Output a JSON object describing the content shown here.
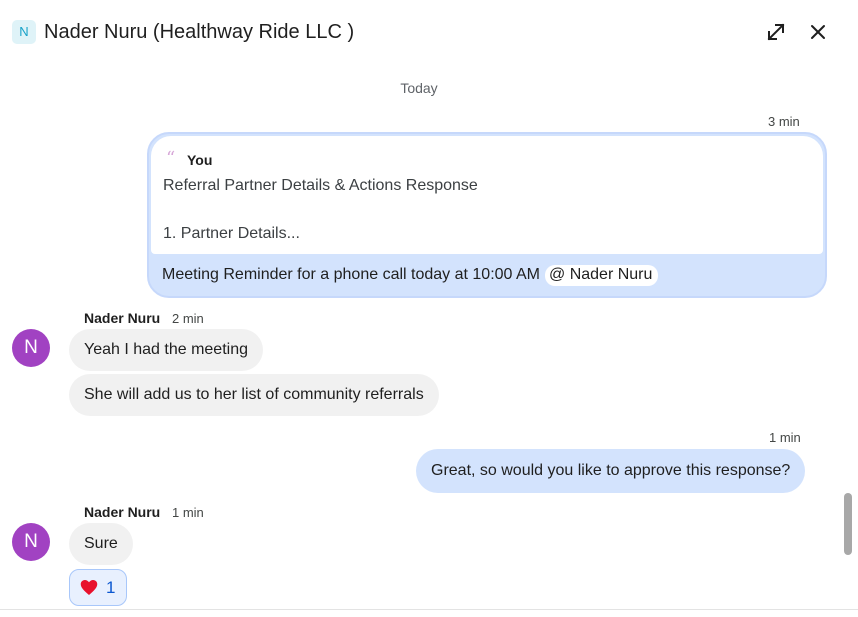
{
  "header": {
    "space_initial": "N",
    "title": "Nader Nuru (Healthway Ride LLC )",
    "expand_icon": "open-in-full-icon",
    "close_icon": "close-icon"
  },
  "day_divider": "Today",
  "messages": [
    {
      "direction": "outgoing",
      "time": "3 min",
      "quote": {
        "author": "You",
        "line1": "Referral Partner Details & Actions Response",
        "line2": "1. Partner Details..."
      },
      "text": "Meeting Reminder for a phone call today at 10:00 AM",
      "mention": "@ Nader Nuru"
    },
    {
      "direction": "incoming",
      "avatar_initial": "N",
      "sender": "Nader Nuru",
      "time": "2 min",
      "bubbles": [
        "Yeah I had the meeting",
        "She will add us to her list of community referrals"
      ]
    },
    {
      "direction": "outgoing",
      "time": "1 min",
      "text": "Great, so would you like to approve this response?"
    },
    {
      "direction": "incoming",
      "avatar_initial": "N",
      "sender": "Nader Nuru",
      "time": "1 min",
      "bubbles": [
        "Sure"
      ],
      "reaction": {
        "icon": "heart-icon",
        "count": "1"
      }
    }
  ],
  "colors": {
    "outgoing_bubble": "#d3e3fd",
    "incoming_bubble": "#f1f1f1",
    "avatar": "#a142c2",
    "reaction_bg": "#e8f0fe"
  }
}
